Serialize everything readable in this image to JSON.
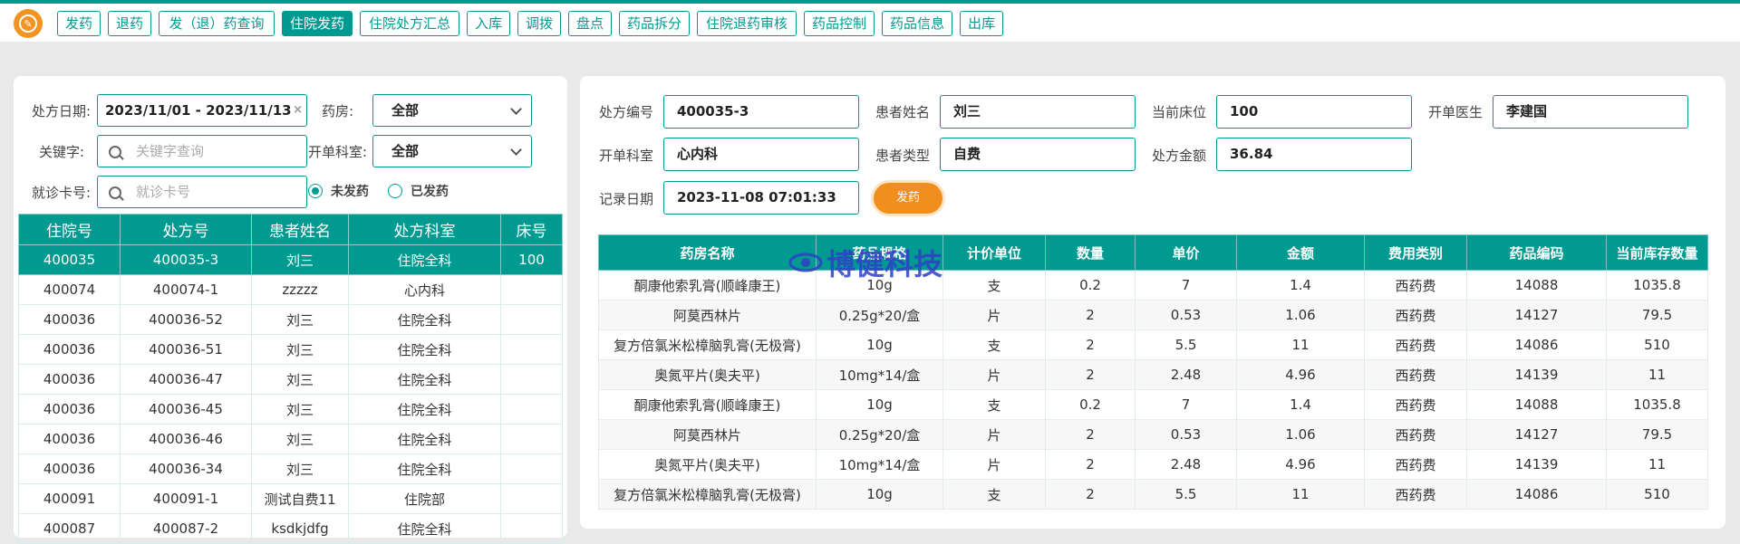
{
  "nav": {
    "tabs": [
      {
        "label": "发药"
      },
      {
        "label": "退药"
      },
      {
        "label": "发（退）药查询"
      },
      {
        "label": "住院发药"
      },
      {
        "label": "住院处方汇总"
      },
      {
        "label": "入库"
      },
      {
        "label": "调拨"
      },
      {
        "label": "盘点"
      },
      {
        "label": "药品拆分"
      },
      {
        "label": "住院退药审核"
      },
      {
        "label": "药品控制"
      },
      {
        "label": "药品信息"
      },
      {
        "label": "出库"
      }
    ],
    "active_index": 3
  },
  "colors": {
    "accent": "#009a91",
    "orange": "#f18f1c",
    "logo": "#f39321"
  },
  "left": {
    "date_label": "处方日期:",
    "date_value": "2023/11/01 - 2023/11/13",
    "pharmacy_label": "药房:",
    "pharmacy_value": "全部",
    "keyword_label": "关键字:",
    "keyword_placeholder": "关键字查询",
    "dept_label": "开单科室:",
    "dept_value": "全部",
    "card_label": "就诊卡号:",
    "card_placeholder": "就诊卡号",
    "radio_unsent": "未发药",
    "radio_sent": "已发药",
    "table": {
      "headers": [
        "住院号",
        "处方号",
        "患者姓名",
        "处方科室",
        "床号"
      ],
      "rows": [
        [
          "400035",
          "400035-3",
          "刘三",
          "住院全科",
          "100"
        ],
        [
          "400074",
          "400074-1",
          "zzzzz",
          "心内科",
          ""
        ],
        [
          "400036",
          "400036-52",
          "刘三",
          "住院全科",
          ""
        ],
        [
          "400036",
          "400036-51",
          "刘三",
          "住院全科",
          ""
        ],
        [
          "400036",
          "400036-47",
          "刘三",
          "住院全科",
          ""
        ],
        [
          "400036",
          "400036-45",
          "刘三",
          "住院全科",
          ""
        ],
        [
          "400036",
          "400036-46",
          "刘三",
          "住院全科",
          ""
        ],
        [
          "400036",
          "400036-34",
          "刘三",
          "住院全科",
          ""
        ],
        [
          "400091",
          "400091-1",
          "测试自费11",
          "住院部",
          ""
        ],
        [
          "400087",
          "400087-2",
          "ksdkjdfg",
          "住院全科",
          ""
        ]
      ]
    }
  },
  "right": {
    "fields": {
      "rx_no_label": "处方编号",
      "rx_no": "400035-3",
      "patient_label": "患者姓名",
      "patient": "刘三",
      "bed_label": "当前床位",
      "bed": "100",
      "doctor_label": "开单医生",
      "doctor": "李建国",
      "dept_label": "开单科室",
      "dept": "心内科",
      "ptype_label": "患者类型",
      "ptype": "自费",
      "amount_label": "处方金额",
      "amount": "36.84",
      "date_label": "记录日期",
      "date": "2023-11-08 07:01:33"
    },
    "dispense_button": "发药",
    "watermark": "博健科技",
    "table": {
      "headers": [
        "药房名称",
        "药品规格",
        "计价单位",
        "数量",
        "单价",
        "金额",
        "费用类别",
        "药品编码",
        "当前库存数量"
      ],
      "rows": [
        [
          "酮康他索乳膏(顺峰康王)",
          "10g",
          "支",
          "0.2",
          "7",
          "1.4",
          "西药费",
          "14088",
          "1035.8"
        ],
        [
          "阿莫西林片",
          "0.25g*20/盒",
          "片",
          "2",
          "0.53",
          "1.06",
          "西药费",
          "14127",
          "79.5"
        ],
        [
          "复方倍氯米松樟脑乳膏(无极膏)",
          "10g",
          "支",
          "2",
          "5.5",
          "11",
          "西药费",
          "14086",
          "510"
        ],
        [
          "奥氮平片(奥夫平)",
          "10mg*14/盒",
          "片",
          "2",
          "2.48",
          "4.96",
          "西药费",
          "14139",
          "11"
        ],
        [
          "酮康他索乳膏(顺峰康王)",
          "10g",
          "支",
          "0.2",
          "7",
          "1.4",
          "西药费",
          "14088",
          "1035.8"
        ],
        [
          "阿莫西林片",
          "0.25g*20/盒",
          "片",
          "2",
          "0.53",
          "1.06",
          "西药费",
          "14127",
          "79.5"
        ],
        [
          "奥氮平片(奥夫平)",
          "10mg*14/盒",
          "片",
          "2",
          "2.48",
          "4.96",
          "西药费",
          "14139",
          "11"
        ],
        [
          "复方倍氯米松樟脑乳膏(无极膏)",
          "10g",
          "支",
          "2",
          "5.5",
          "11",
          "西药费",
          "14086",
          "510"
        ]
      ]
    }
  }
}
